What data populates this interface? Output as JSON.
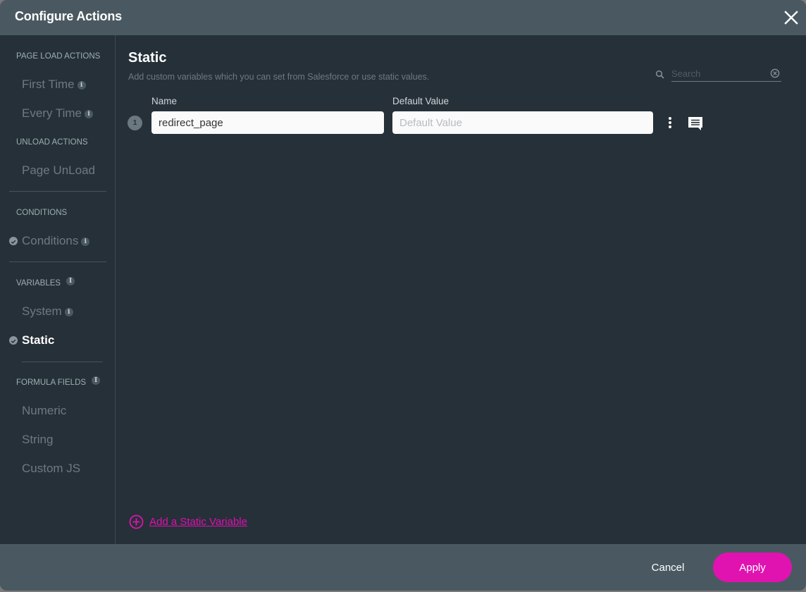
{
  "header": {
    "title": "Configure Actions"
  },
  "sidebar": {
    "sections": {
      "page_load": "PAGE LOAD ACTIONS",
      "unload": "UNLOAD ACTIONS",
      "conditions": "CONDITIONS",
      "variables": "VARIABLES",
      "formula": "FORMULA FIELDS"
    },
    "items": {
      "first_time": "First Time",
      "every_time": "Every Time",
      "page_unload": "Page UnLoad",
      "conditions": "Conditions",
      "system": "System",
      "static": "Static",
      "numeric": "Numeric",
      "string": "String",
      "custom_js": "Custom JS"
    },
    "info_glyph": "i",
    "active_item": "Static"
  },
  "main": {
    "title": "Static",
    "description": "Add custom variables which you can set from Salesforce or use static values.",
    "search": {
      "placeholder": "Search",
      "value": ""
    },
    "columns": {
      "name": "Name",
      "default_value": "Default Value"
    },
    "rows": [
      {
        "index": "1",
        "name": "redirect_page",
        "default_value": "",
        "default_placeholder": "Default Value"
      }
    ],
    "add_link": "Add a Static Variable"
  },
  "footer": {
    "cancel": "Cancel",
    "apply": "Apply"
  },
  "colors": {
    "accent": "#e013b0",
    "header_bg": "#4a5961",
    "body_bg": "#263038"
  }
}
